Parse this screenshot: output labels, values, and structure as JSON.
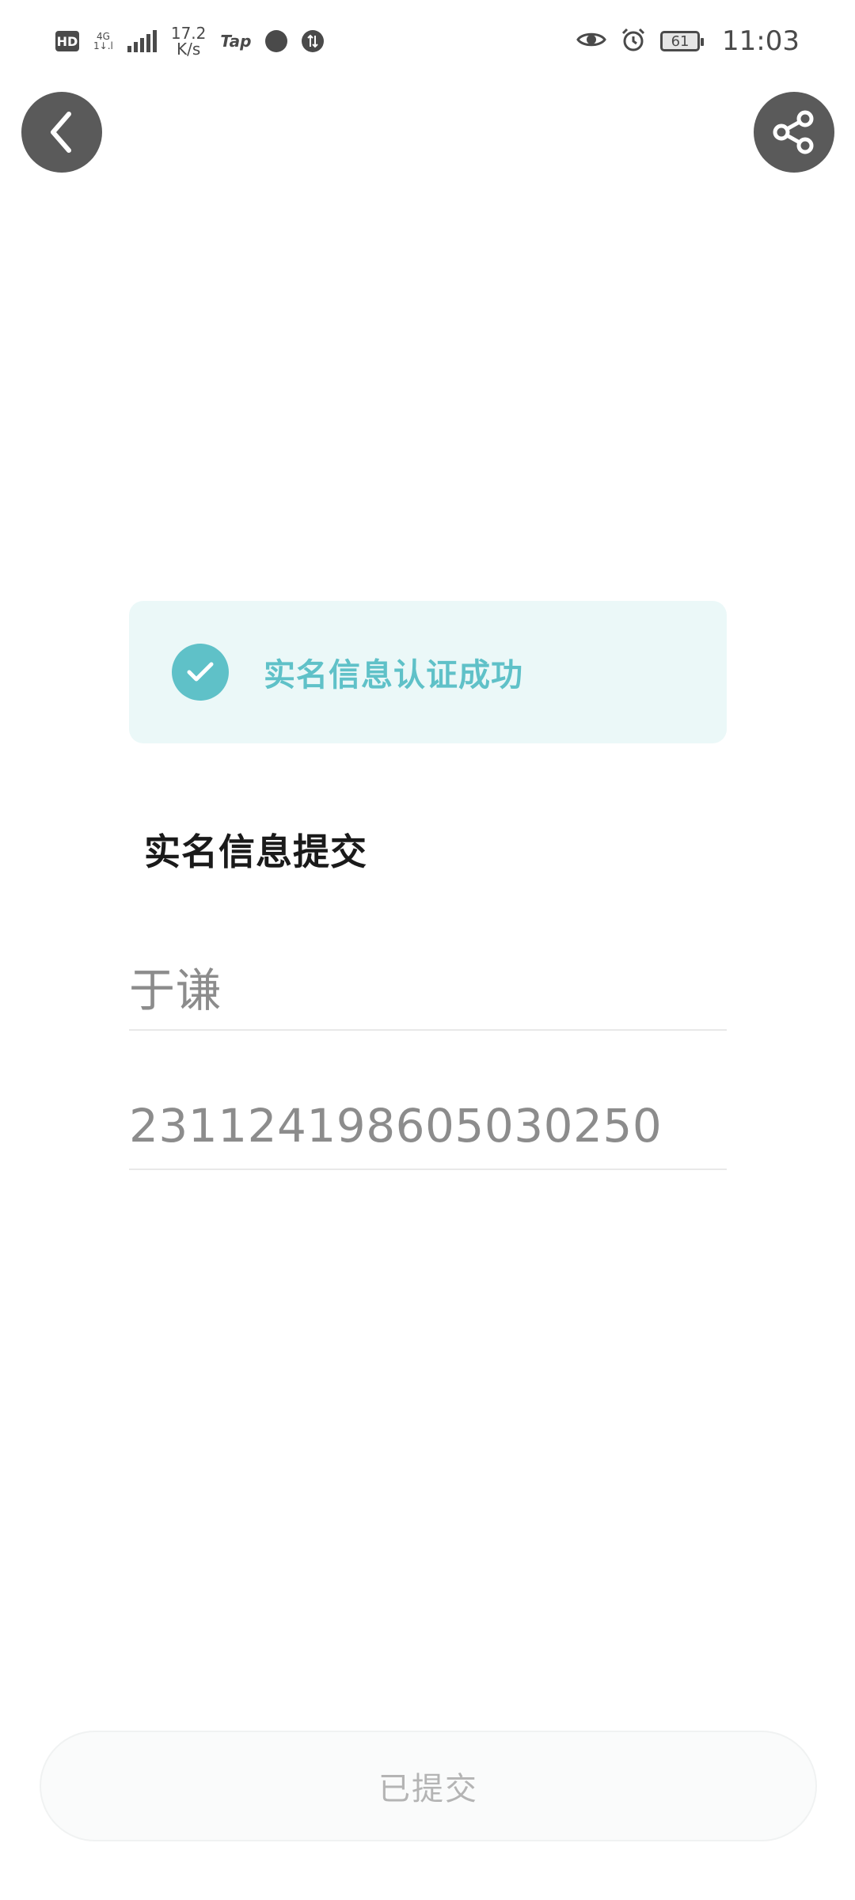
{
  "status_bar": {
    "hd": "HD",
    "net_top": "4G",
    "net_bottom": "1↓.l",
    "speed_value": "17.2",
    "speed_unit": "K/s",
    "tap": "Tap",
    "battery": "61",
    "time": "11:03"
  },
  "banner": {
    "text": "实名信息认证成功",
    "accent_color": "#5fc1c8"
  },
  "section": {
    "title": "实名信息提交"
  },
  "form": {
    "name_value": "于谦",
    "id_value": "231124198605030250"
  },
  "submit": {
    "label": "已提交"
  },
  "icons": {
    "back": "chevron-left-icon",
    "share": "share-icon",
    "check": "check-icon"
  }
}
